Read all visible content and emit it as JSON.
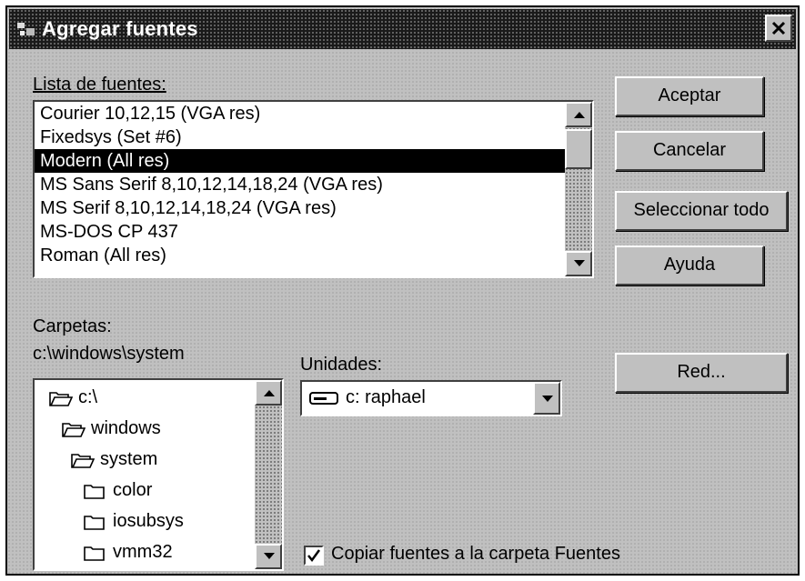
{
  "window": {
    "title": "Agregar fuentes"
  },
  "font_list": {
    "label": "Lista de fuentes:",
    "items": [
      "Courier 10,12,15 (VGA res)",
      "Fixedsys (Set #6)",
      "Modern (All res)",
      "MS Sans Serif 8,10,12,14,18,24 (VGA res)",
      "MS Serif 8,10,12,14,18,24 (VGA res)",
      "MS-DOS CP 437",
      "Roman (All res)"
    ],
    "selected": "Modern (All res)"
  },
  "buttons": {
    "accept": "Aceptar",
    "cancel": "Cancelar",
    "select_all": "Seleccionar todo",
    "help": "Ayuda",
    "network": "Red..."
  },
  "folders": {
    "label": "Carpetas:",
    "path": "c:\\windows\\system",
    "items": [
      "c:\\",
      "windows",
      "system",
      "color",
      "iosubsys",
      "vmm32"
    ]
  },
  "drives": {
    "label": "Unidades:",
    "selected": "c: raphael"
  },
  "copy_option": {
    "label": "Copiar fuentes a la carpeta Fuentes",
    "checked": true
  },
  "icons": [
    "app-icon",
    "close-icon",
    "scroll-up-icon",
    "scroll-down-icon",
    "open-folder-icon",
    "closed-folder-icon",
    "drive-icon",
    "dropdown-arrow-icon",
    "checkmark-icon"
  ]
}
